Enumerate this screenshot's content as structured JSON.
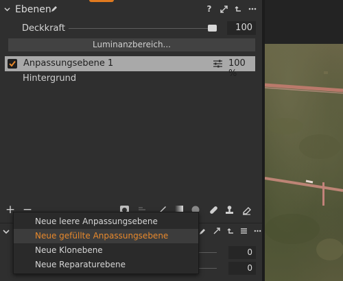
{
  "layers_panel": {
    "title": "Ebenen",
    "help_label": "?",
    "opacity_label": "Deckkraft",
    "opacity_value": "100",
    "opacity_slider_level": 1.0,
    "luminance_button": "Luminanzbereich...",
    "layers": [
      {
        "name": "Anpassungsebene 1",
        "checked": true,
        "selected": true,
        "opacity": "100 %"
      },
      {
        "name": "Hintergrund",
        "checked": false,
        "selected": false
      }
    ],
    "toolbar_add": "+",
    "toolbar_remove": "−"
  },
  "context_menu": {
    "items": [
      {
        "label": "Neue leere Anpassungsebene",
        "highlighted": false
      },
      {
        "label": "Neue gefüllte Anpassungsebene",
        "highlighted": true
      },
      {
        "label": "Neue Klonebene",
        "highlighted": false
      },
      {
        "label": "Neue Reparaturebene",
        "highlighted": false
      }
    ]
  },
  "lower_panel": {
    "values": [
      "0",
      "0"
    ]
  },
  "colors": {
    "accent": "#e8892c",
    "selected_row": "#a9a9a9",
    "panel_bg": "#2f2f2f"
  },
  "icons": [
    "chevron-down-icon",
    "pen-icon",
    "help-icon",
    "expand-icon",
    "reset-icon",
    "more-icon",
    "adjustment-sliders-icon",
    "checkbox-icon",
    "add-icon",
    "remove-icon",
    "mask-icon",
    "brush-icon",
    "gradient-icon",
    "eraser-icon",
    "stamp-icon",
    "heal-icon"
  ]
}
